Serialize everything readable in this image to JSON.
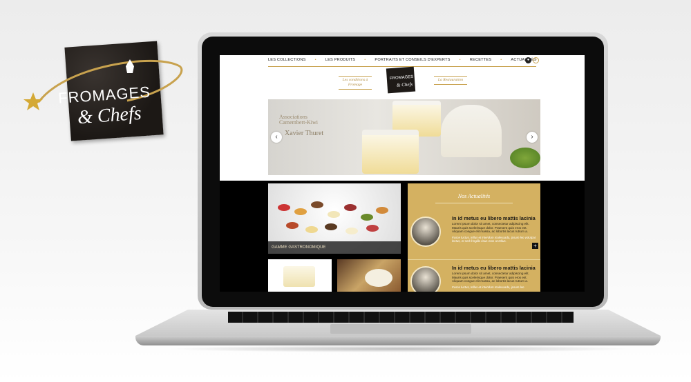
{
  "logo": {
    "line1": "FROMAGES",
    "line2": "& Chefs"
  },
  "site": {
    "nav": [
      {
        "label": "LES COLLECTIONS"
      },
      {
        "label": "LES PRODUITS"
      },
      {
        "label": "PORTRAITS ET CONSEILS D'EXPERTS"
      },
      {
        "label": "RECETTES"
      },
      {
        "label": "ACTUALITÉS"
      }
    ],
    "sub_left": "Les conditions à Fromage",
    "sub_right": "La Restauration",
    "mini_logo": {
      "line1": "FROMAGES",
      "line2": "& Chefs"
    },
    "hero": {
      "line1": "Associations",
      "line2": "Camembert-Kiwi",
      "author": "Xavier Thuret",
      "prev": "‹",
      "next": "›"
    },
    "promo_label": "GAMME GASTRONOMIQUE",
    "news": {
      "title": "Nos Actualités",
      "items": [
        {
          "heading": "In id metus eu libero mattis lacinia",
          "body": "Lorem ipsum dolor sit amet, consectetur adipiscing elit. Mauris quis scelerisque dolor. Praesent quis eros est. Aliquam congue elit massa, ac lobortis lacus rutrum a.",
          "quote": "Fusce luctus, tellus et interdum malesuada, ipsum leo volutpat lectus, et sed fringilla risus eros at tellus."
        },
        {
          "heading": "In id metus eu libero mattis lacinia",
          "body": "Lorem ipsum dolor sit amet, consectetur adipiscing elit. Mauris quis scelerisque dolor. Praesent quis eros est. Aliquam congue elit massa, ac lobortis lacus rutrum a.",
          "quote": "Fusce luctus, tellus et interdum malesuada, ipsum leo"
        }
      ],
      "more": "+"
    }
  },
  "colors": {
    "gold": "#c8a24e",
    "news_bg": "#d4b161",
    "dark": "#1c1815"
  }
}
